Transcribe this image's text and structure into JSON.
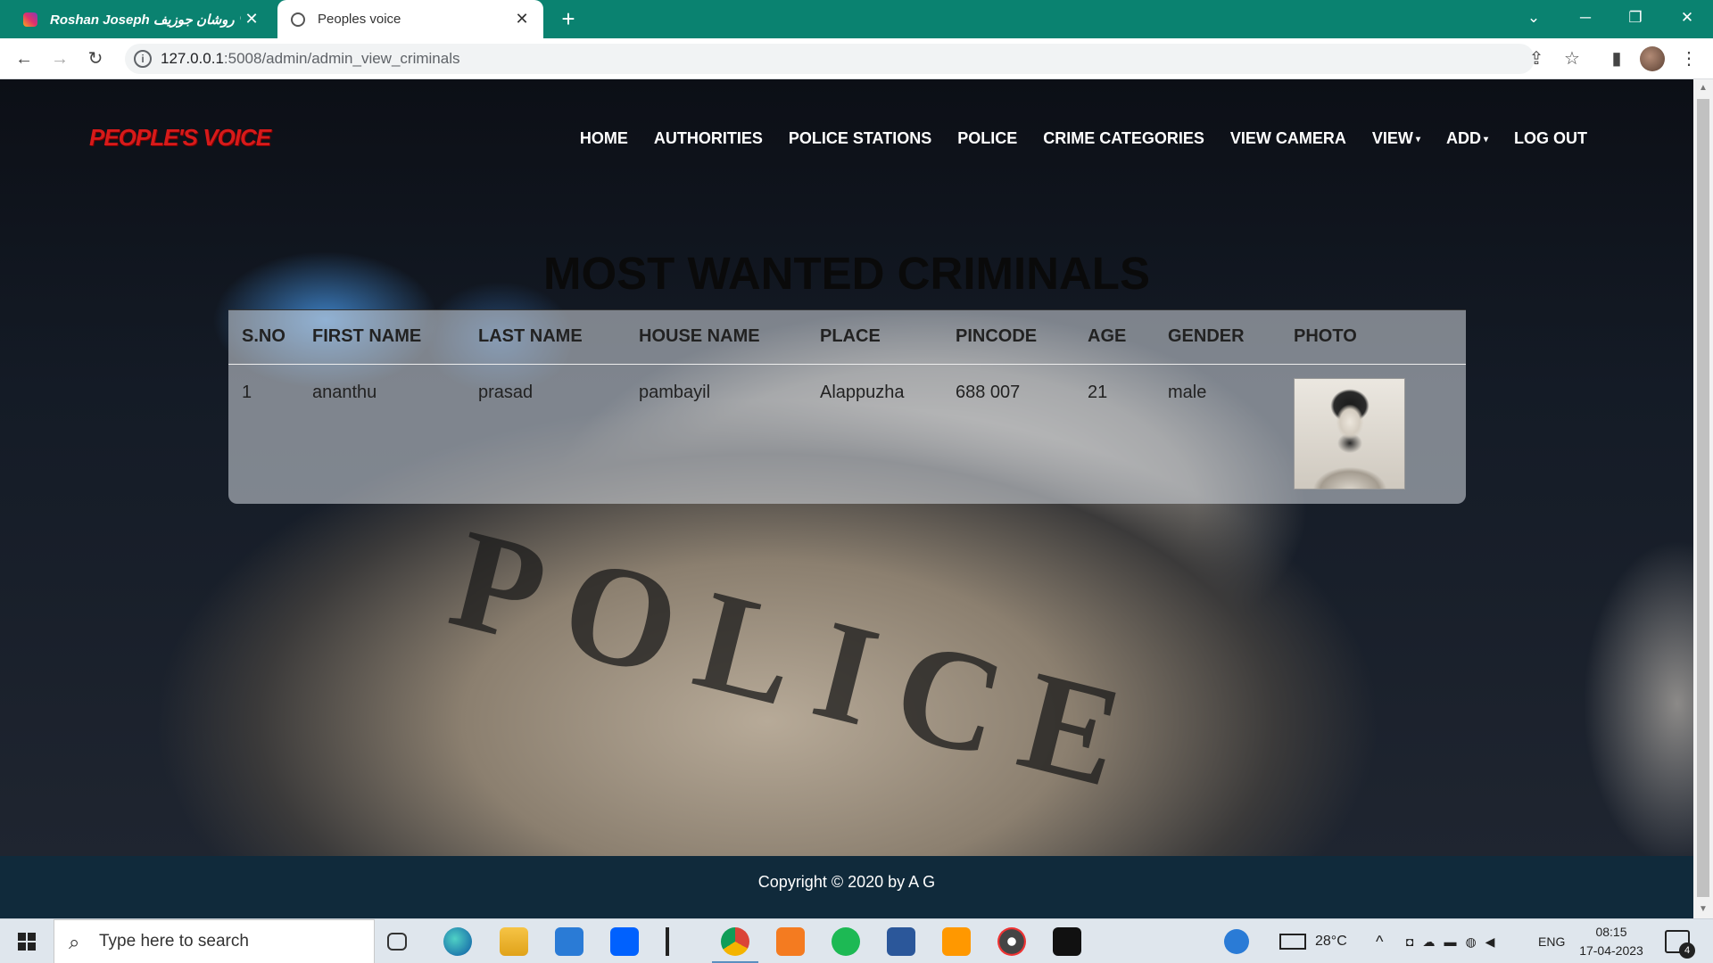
{
  "browser": {
    "tabs": [
      {
        "title": "Roshan Joseph روشان جوزيف 🤍",
        "close": "✕"
      },
      {
        "title": "Peoples voice",
        "close": "✕"
      }
    ],
    "new_tab": "+",
    "window_controls": {
      "list": "⌄",
      "minimize": "─",
      "restore": "❐",
      "close": "✕"
    },
    "nav": {
      "back": "←",
      "forward": "→",
      "reload": "↻"
    },
    "url_host": "127.0.0.1",
    "url_path": ":5008/admin/admin_view_criminals",
    "info_icon": "i",
    "actions": {
      "share": "⇪",
      "bookmark": "☆",
      "sidebar": "▮",
      "menu": "⋮"
    }
  },
  "site": {
    "logo": "PEOPLE'S VOICE",
    "nav": [
      {
        "label": "HOME"
      },
      {
        "label": "AUTHORITIES"
      },
      {
        "label": "POLICE STATIONS"
      },
      {
        "label": "POLICE"
      },
      {
        "label": "CRIME CATEGORIES"
      },
      {
        "label": "VIEW CAMERA"
      },
      {
        "label": "VIEW",
        "caret": "▾"
      },
      {
        "label": "ADD",
        "caret": "▾"
      },
      {
        "label": "LOG OUT"
      }
    ],
    "background_text": "POLICE",
    "heading": "MOST WANTED CRIMINALS",
    "table": {
      "columns": [
        "S.NO",
        "FIRST NAME",
        "LAST NAME",
        "HOUSE NAME",
        "PLACE",
        "PINCODE",
        "AGE",
        "GENDER",
        "PHOTO"
      ],
      "rows": [
        [
          "1",
          "ananthu",
          "prasad",
          "pambayil",
          "Alappuzha",
          "688 007",
          "21",
          "male"
        ]
      ]
    },
    "footer": "Copyright © 2020 by A G"
  },
  "scrollbar": {
    "up": "▲",
    "down": "▼"
  },
  "taskbar": {
    "search_placeholder": "Type here to search",
    "search_icon": "⌕",
    "weather": "28°C",
    "language": "ENG",
    "time": "08:15",
    "date": "17-04-2023",
    "notifications": "4",
    "tray_up": "^"
  }
}
